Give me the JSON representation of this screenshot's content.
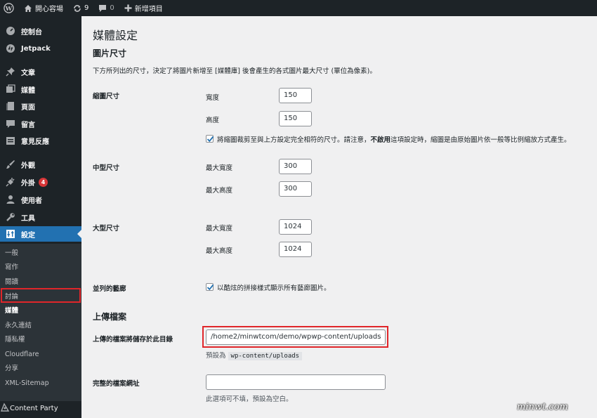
{
  "adminbar": {
    "wp_logo": "wordpress-logo",
    "site_name": "開心容場",
    "updates_count": "9",
    "comments_count": "0",
    "new_label": "新增項目"
  },
  "sidebar": {
    "items": [
      {
        "label": "控制台",
        "icon": "dashboard-icon"
      },
      {
        "label": "Jetpack",
        "icon": "jetpack-icon"
      },
      {
        "label": "文章",
        "icon": "pin-icon"
      },
      {
        "label": "媒體",
        "icon": "media-icon"
      },
      {
        "label": "頁面",
        "icon": "page-icon"
      },
      {
        "label": "留言",
        "icon": "comment-icon"
      },
      {
        "label": "意見反應",
        "icon": "feedback-icon"
      },
      {
        "label": "外觀",
        "icon": "brush-icon"
      },
      {
        "label": "外掛",
        "icon": "plugin-icon",
        "badge": "4"
      },
      {
        "label": "使用者",
        "icon": "user-icon"
      },
      {
        "label": "工具",
        "icon": "wrench-icon"
      },
      {
        "label": "設定",
        "icon": "settings-icon"
      }
    ],
    "submenu": [
      "一般",
      "寫作",
      "閱讀",
      "討論",
      "媒體",
      "永久連結",
      "隱私權",
      "Cloudflare",
      "分享",
      "XML-Sitemap"
    ],
    "bottom_item": "Content Party",
    "accent_color": "#2271b1",
    "highlight_color": "#e0262a"
  },
  "page": {
    "title": "媒體設定",
    "section_image_sizes": "圖片尺寸",
    "description": "下方所列出的尺寸，決定了將圖片新增至 [媒體庫] 後會產生的各式圖片最大尺寸 (單位為像素)。",
    "thumbnail": {
      "label": "縮圖尺寸",
      "width_label": "寬度",
      "width_value": "150",
      "height_label": "高度",
      "height_value": "150",
      "crop_checked": true,
      "crop_text_before": "將縮圖裁剪至與上方設定完全相符的尺寸。請注意，",
      "crop_text_bold": "不啟用",
      "crop_text_after": "這項設定時，縮圖是由原始圖片依一般等比例縮放方式產生。"
    },
    "medium": {
      "label": "中型尺寸",
      "max_width_label": "最大寬度",
      "max_width_value": "300",
      "max_height_label": "最大高度",
      "max_height_value": "300"
    },
    "large": {
      "label": "大型尺寸",
      "max_width_label": "最大寬度",
      "max_width_value": "1024",
      "max_height_label": "最大高度",
      "max_height_value": "1024"
    },
    "gallery": {
      "label": "並列的藝廊",
      "checked": true,
      "text": "以酷炫的拼接樣式顯示所有藝廊圖片。"
    },
    "section_uploads": "上傳檔案",
    "upload_path": {
      "label": "上傳的檔案將儲存於此目錄",
      "value": "/home2/minwtcom/demo/wpwp-content/uploads",
      "default_prefix": "預設為",
      "default_value": "wp-content/uploads"
    },
    "upload_url": {
      "label": "完整的檔案網址",
      "value": "",
      "note": "此選項可不填，預設為空白。"
    }
  },
  "watermark": "minwt.com"
}
